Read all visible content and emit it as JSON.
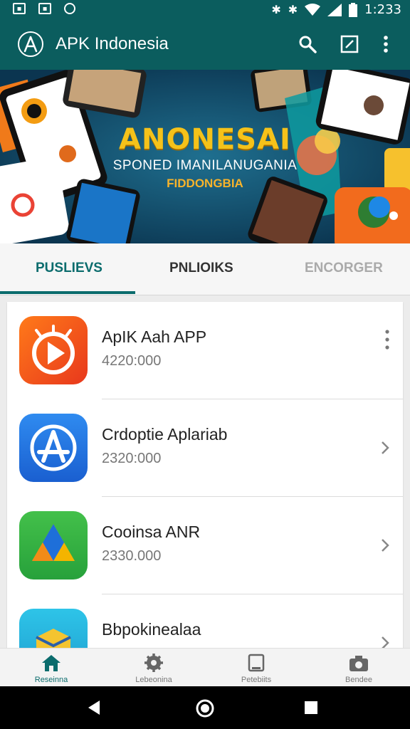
{
  "status_bar": {
    "time": "1:233"
  },
  "app_bar": {
    "title": "APK Indonesia"
  },
  "banner": {
    "title": "ANONESAI",
    "subtitle": "SPONED IMANILANUGANIA",
    "tagline": "FIDDONGBIA"
  },
  "tabs": [
    {
      "label": "PUSLIEVS",
      "active": true
    },
    {
      "label": "PNLIOIKS",
      "active": false
    },
    {
      "label": "ENCORGER",
      "active": false
    }
  ],
  "apps": [
    {
      "name": "ApIK Aah APP",
      "size": "4220:000",
      "icon": "play-icon",
      "trailing": "more"
    },
    {
      "name": "Crdoptie Aplariab",
      "size": "2320:000",
      "icon": "app-store-icon",
      "trailing": "chevron"
    },
    {
      "name": "Cooinsa ANR",
      "size": "2330.000",
      "icon": "drive-icon",
      "trailing": "chevron"
    },
    {
      "name": "Bbpokinealaa",
      "size": "",
      "icon": "package-icon",
      "trailing": "chevron"
    }
  ],
  "bottom_nav": [
    {
      "label": "Reseinna",
      "icon": "home-icon",
      "active": true
    },
    {
      "label": "Lebeonina",
      "icon": "gear-icon",
      "active": false
    },
    {
      "label": "Petebiits",
      "icon": "document-icon",
      "active": false
    },
    {
      "label": "Bendee",
      "icon": "camera-icon",
      "active": false
    }
  ],
  "colors": {
    "primary": "#0b5d5e",
    "accent": "#0b6c6d",
    "banner_title": "#f5c21a"
  }
}
